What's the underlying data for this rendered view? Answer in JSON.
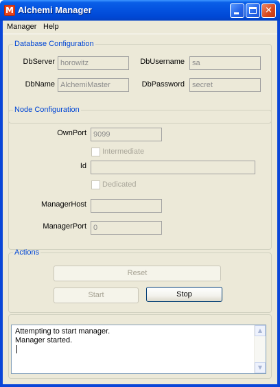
{
  "window": {
    "title": "Alchemi Manager",
    "app_icon_glyph": "M"
  },
  "menu": [
    {
      "label": "Manager"
    },
    {
      "label": "Help"
    }
  ],
  "db": {
    "legend": "Database Configuration",
    "server_label": "DbServer",
    "server_value": "horowitz",
    "name_label": "DbName",
    "name_value": "AlchemiMaster",
    "username_label": "DbUsername",
    "username_value": "sa",
    "password_label": "DbPassword",
    "password_value": "secret"
  },
  "node": {
    "legend": "Node Configuration",
    "ownport_label": "OwnPort",
    "ownport_value": "9099",
    "intermediate_label": "Intermediate",
    "intermediate_checked": false,
    "id_label": "Id",
    "id_value": "",
    "dedicated_label": "Dedicated",
    "dedicated_checked": false,
    "managerhost_label": "ManagerHost",
    "managerhost_value": "",
    "managerport_label": "ManagerPort",
    "managerport_value": "0"
  },
  "actions": {
    "legend": "Actions",
    "reset_label": "Reset",
    "reset_enabled": false,
    "start_label": "Start",
    "start_enabled": false,
    "stop_label": "Stop",
    "stop_enabled": true
  },
  "log": {
    "lines": [
      "Attempting to start manager.",
      "Manager started."
    ]
  },
  "colors": {
    "titlebar": "#0453e0",
    "client_bg": "#ece9d8",
    "legend_text": "#0046d5",
    "close_button": "#d9471d"
  }
}
